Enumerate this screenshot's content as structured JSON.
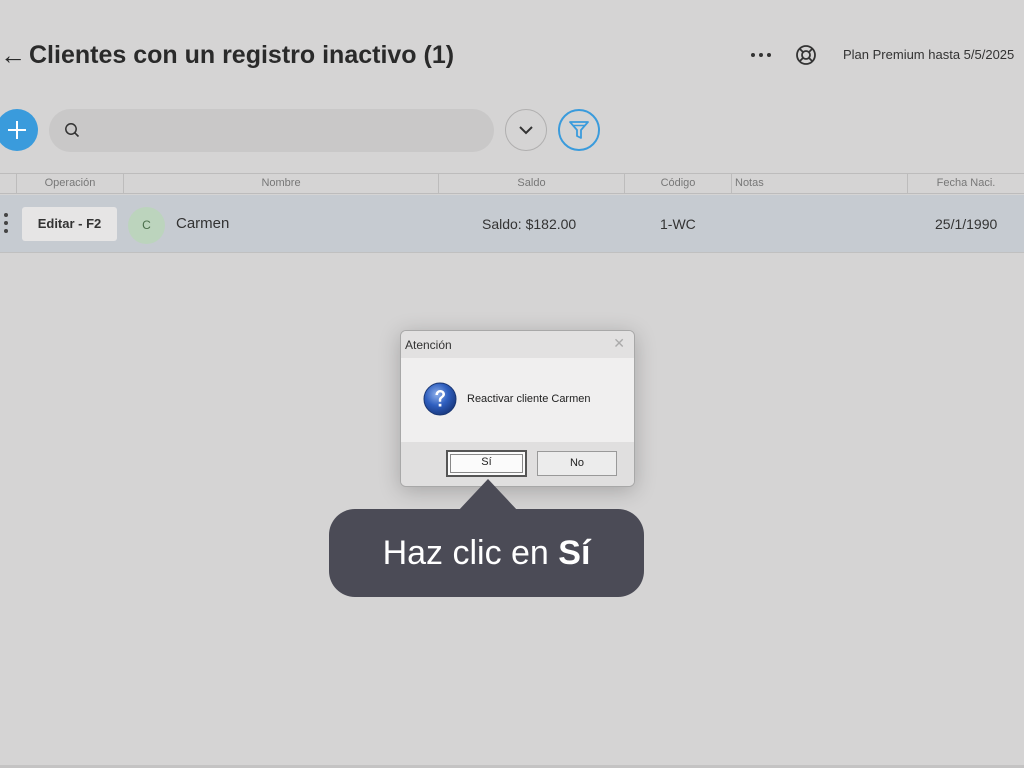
{
  "header": {
    "back_icon": "back-arrow-icon",
    "title": "Clientes con un registro inactivo (1)",
    "more_icon": "more-horizontal-icon",
    "support_icon": "lifebuoy-icon",
    "plan_text": "Plan Premium hasta 5/5/2025"
  },
  "toolbar": {
    "add_icon": "plus-icon",
    "search_icon": "search-icon",
    "search_value": "",
    "search_placeholder": "",
    "dropdown_icon": "chevron-down-icon",
    "filter_icon": "filter-icon"
  },
  "table": {
    "columns": [
      "Operación",
      "Nombre",
      "Saldo",
      "Código",
      "Notas",
      "Fecha Naci."
    ],
    "rows": [
      {
        "edit_label": "Editar - F2",
        "avatar": "C",
        "name": "Carmen",
        "balance": "Saldo: $182.00",
        "code": "1-WC",
        "notes": "",
        "birth_date": "25/1/1990"
      }
    ]
  },
  "dialog": {
    "title": "Atención",
    "close_icon": "close-icon",
    "icon": "question-icon",
    "message": "Reactivar cliente Carmen",
    "yes_label": "Sí",
    "no_label": "No"
  },
  "tooltip": {
    "text": "Haz clic en ",
    "bold": "Sí"
  },
  "colors": {
    "background": "#d5d4d4",
    "accent": "#3a9bdc",
    "row_highlight": "#c6cbd1",
    "tooltip": "#4b4b56"
  }
}
